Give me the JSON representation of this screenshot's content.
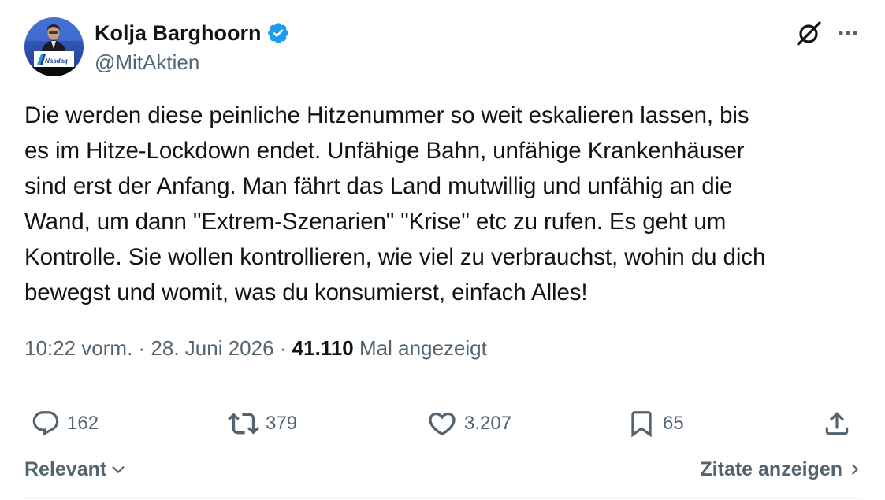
{
  "author": {
    "display_name": "Kolja Barghoorn",
    "handle": "@MitAktien",
    "verified": true,
    "avatar_banner_text": "Nasdaq"
  },
  "tweet": {
    "text": "Die werden diese peinliche Hitzenummer so weit eskalieren lassen, bis\nes im Hitze-Lockdown endet. Unfähige Bahn, unfähige Krankenhäuser\nsind erst der Anfang. Man fährt das Land mutwillig und unfähig an die\nWand, um dann \"Extrem-Szenarien\" \"Krise\" etc zu rufen. Es geht um\nKontrolle. Sie wollen kontrollieren, wie viel zu verbrauchst, wohin du dich\nbewegst und womit, was du konsumierst, einfach Alles!",
    "time": "10:22 vorm.",
    "separator": " · ",
    "date": "28. Juni 2026",
    "views_count": "41.110",
    "views_label": "Mal angezeigt"
  },
  "actions": {
    "replies": "162",
    "reposts": "379",
    "likes": "3.207",
    "bookmarks": "65"
  },
  "footer": {
    "sort_label": "Relevant",
    "quotes_label": "Zitate anzeigen"
  },
  "colors": {
    "text_primary": "#0f1419",
    "text_secondary": "#536471",
    "verified_blue": "#1d9bf0",
    "divider": "#eff3f4"
  },
  "icons": {
    "grok": "grok-icon",
    "more": "more-icon",
    "reply": "reply-icon",
    "repost": "repost-icon",
    "like": "heart-icon",
    "bookmark": "bookmark-icon",
    "share": "share-icon",
    "sort_chevron": "chevron-down-icon",
    "quotes_chevron": "chevron-right-icon"
  }
}
